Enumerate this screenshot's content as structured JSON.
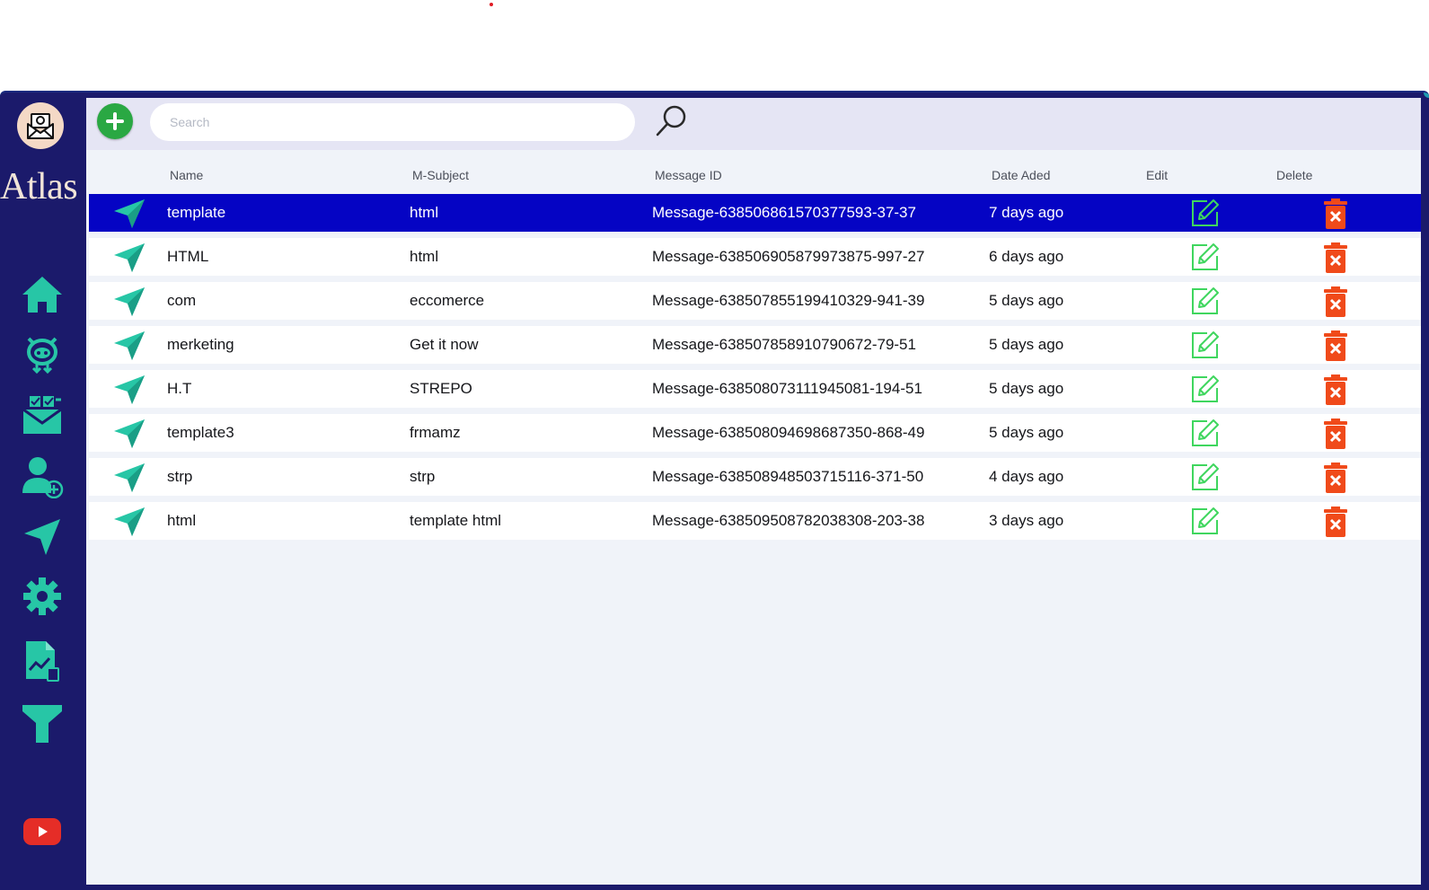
{
  "app": {
    "title": "Atlas"
  },
  "sidebar": {
    "items": [
      {
        "icon": "home-icon"
      },
      {
        "icon": "robot-icon"
      },
      {
        "icon": "mail-tasks-icon"
      },
      {
        "icon": "add-user-icon"
      },
      {
        "icon": "send-icon"
      },
      {
        "icon": "gear-icon"
      },
      {
        "icon": "report-icon"
      },
      {
        "icon": "filter-icon"
      },
      {
        "icon": "youtube-icon"
      }
    ],
    "accent_color": "#27c6a6"
  },
  "search": {
    "placeholder": "Search",
    "value": ""
  },
  "table": {
    "headers": {
      "name": "Name",
      "subject": "M-Subject",
      "message_id": "Message ID",
      "date": "Date Aded",
      "edit": "Edit",
      "delete": "Delete"
    },
    "selected_index": 0,
    "rows": [
      {
        "name": "template",
        "subject": "html",
        "message_id": "Message-638506861570377593-37-37",
        "date": "7 days ago"
      },
      {
        "name": "HTML",
        "subject": "html",
        "message_id": "Message-638506905879973875-997-27",
        "date": "6 days ago"
      },
      {
        "name": "com",
        "subject": "eccomerce",
        "message_id": "Message-638507855199410329-941-39",
        "date": "5 days ago"
      },
      {
        "name": "merketing",
        "subject": "Get it now",
        "message_id": "Message-638507858910790672-79-51",
        "date": "5 days ago"
      },
      {
        "name": "H.T",
        "subject": "STREPO",
        "message_id": "Message-638508073111945081-194-51",
        "date": "5 days ago"
      },
      {
        "name": "template3",
        "subject": "frmamz",
        "message_id": "Message-638508094698687350-868-49",
        "date": "5 days ago"
      },
      {
        "name": "strp",
        "subject": "strp",
        "message_id": "Message-638508948503715116-371-50",
        "date": "4 days ago"
      },
      {
        "name": "html",
        "subject": "template html",
        "message_id": "Message-638509508782038308-203-38",
        "date": "3 days ago"
      }
    ]
  },
  "colors": {
    "selected_row": "#0504c4",
    "sidebar_bg": "#1b1a6b",
    "delete": "#f04a1a",
    "edit": "#3fd65e",
    "add": "#2aa843"
  }
}
